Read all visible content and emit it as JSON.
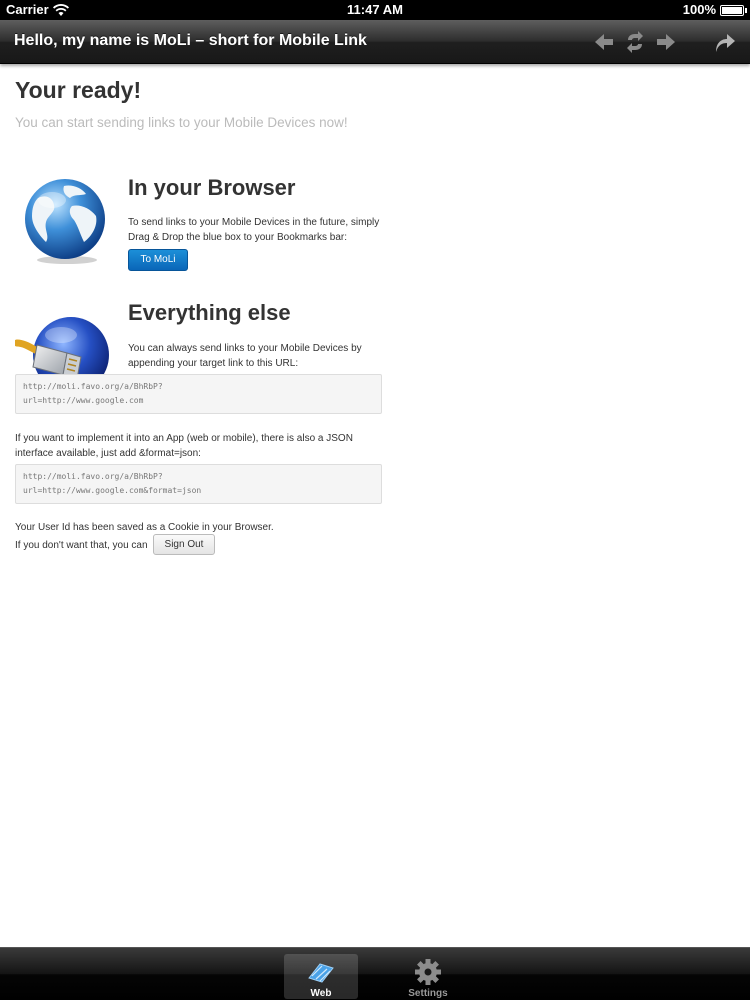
{
  "status_bar": {
    "carrier": "Carrier",
    "time": "11:47 AM",
    "battery": "100%"
  },
  "nav": {
    "title": "Hello, my name is MoLi – short for Mobile Link"
  },
  "page": {
    "heading": "Your ready!",
    "subheading": "You can start sending links to your Mobile Devices now!",
    "browser_section": {
      "title": "In your Browser",
      "text_line1": "To send links to your Mobile Devices in the future, simply",
      "text_line2": "Drag & Drop the blue box to your Bookmarks bar:",
      "button_label": "To MoLi"
    },
    "else_section": {
      "title": "Everything else",
      "text_line1": "You can always send links to your Mobile Devices by",
      "text_line2": "appending your target link to this URL:",
      "code_line1": "http://moli.favo.org/a/BhRbP?",
      "code_line2": "url=http://www.google.com"
    },
    "json_section": {
      "text_line1": "If you want to implement it into an App (web or mobile), there is also a JSON",
      "text_line2": "interface available, just add &format=json:",
      "code_line1": "http://moli.favo.org/a/BhRbP?",
      "code_line2": "url=http://www.google.com&format=json"
    },
    "cookie_note": "Your User Id has been saved as a Cookie in your Browser.",
    "sign_out_prompt": "If you don't want that, you can",
    "sign_out_label": "Sign Out"
  },
  "tabs": [
    {
      "label": "Web",
      "icon": "web-icon",
      "active": true
    },
    {
      "label": "Settings",
      "icon": "gear-icon",
      "active": false
    }
  ],
  "colors": {
    "accent": "#0a66b8",
    "nav_bar": "#2c2c2c",
    "subheading": "#bbbbbb"
  }
}
